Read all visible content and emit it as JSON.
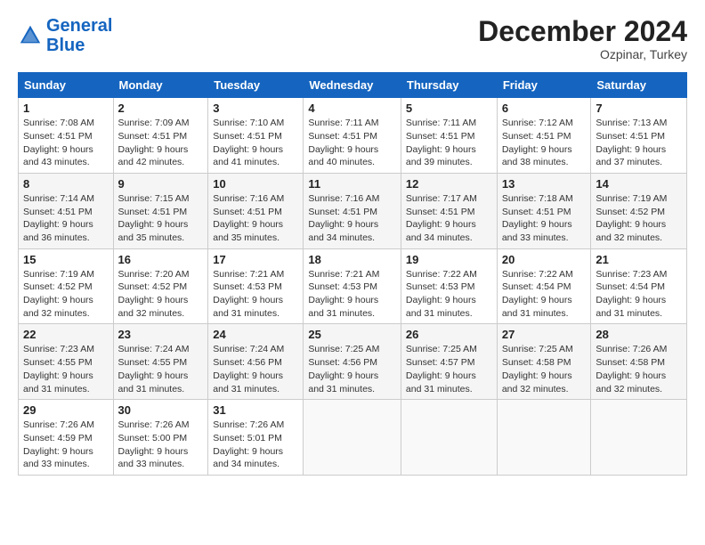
{
  "logo": {
    "line1": "General",
    "line2": "Blue"
  },
  "title": "December 2024",
  "location": "Ozpinar, Turkey",
  "days_header": [
    "Sunday",
    "Monday",
    "Tuesday",
    "Wednesday",
    "Thursday",
    "Friday",
    "Saturday"
  ],
  "weeks": [
    [
      {
        "num": "1",
        "rise": "7:08 AM",
        "set": "4:51 PM",
        "daylight": "9 hours and 43 minutes."
      },
      {
        "num": "2",
        "rise": "7:09 AM",
        "set": "4:51 PM",
        "daylight": "9 hours and 42 minutes."
      },
      {
        "num": "3",
        "rise": "7:10 AM",
        "set": "4:51 PM",
        "daylight": "9 hours and 41 minutes."
      },
      {
        "num": "4",
        "rise": "7:11 AM",
        "set": "4:51 PM",
        "daylight": "9 hours and 40 minutes."
      },
      {
        "num": "5",
        "rise": "7:11 AM",
        "set": "4:51 PM",
        "daylight": "9 hours and 39 minutes."
      },
      {
        "num": "6",
        "rise": "7:12 AM",
        "set": "4:51 PM",
        "daylight": "9 hours and 38 minutes."
      },
      {
        "num": "7",
        "rise": "7:13 AM",
        "set": "4:51 PM",
        "daylight": "9 hours and 37 minutes."
      }
    ],
    [
      {
        "num": "8",
        "rise": "7:14 AM",
        "set": "4:51 PM",
        "daylight": "9 hours and 36 minutes."
      },
      {
        "num": "9",
        "rise": "7:15 AM",
        "set": "4:51 PM",
        "daylight": "9 hours and 35 minutes."
      },
      {
        "num": "10",
        "rise": "7:16 AM",
        "set": "4:51 PM",
        "daylight": "9 hours and 35 minutes."
      },
      {
        "num": "11",
        "rise": "7:16 AM",
        "set": "4:51 PM",
        "daylight": "9 hours and 34 minutes."
      },
      {
        "num": "12",
        "rise": "7:17 AM",
        "set": "4:51 PM",
        "daylight": "9 hours and 34 minutes."
      },
      {
        "num": "13",
        "rise": "7:18 AM",
        "set": "4:51 PM",
        "daylight": "9 hours and 33 minutes."
      },
      {
        "num": "14",
        "rise": "7:19 AM",
        "set": "4:52 PM",
        "daylight": "9 hours and 32 minutes."
      }
    ],
    [
      {
        "num": "15",
        "rise": "7:19 AM",
        "set": "4:52 PM",
        "daylight": "9 hours and 32 minutes."
      },
      {
        "num": "16",
        "rise": "7:20 AM",
        "set": "4:52 PM",
        "daylight": "9 hours and 32 minutes."
      },
      {
        "num": "17",
        "rise": "7:21 AM",
        "set": "4:53 PM",
        "daylight": "9 hours and 31 minutes."
      },
      {
        "num": "18",
        "rise": "7:21 AM",
        "set": "4:53 PM",
        "daylight": "9 hours and 31 minutes."
      },
      {
        "num": "19",
        "rise": "7:22 AM",
        "set": "4:53 PM",
        "daylight": "9 hours and 31 minutes."
      },
      {
        "num": "20",
        "rise": "7:22 AM",
        "set": "4:54 PM",
        "daylight": "9 hours and 31 minutes."
      },
      {
        "num": "21",
        "rise": "7:23 AM",
        "set": "4:54 PM",
        "daylight": "9 hours and 31 minutes."
      }
    ],
    [
      {
        "num": "22",
        "rise": "7:23 AM",
        "set": "4:55 PM",
        "daylight": "9 hours and 31 minutes."
      },
      {
        "num": "23",
        "rise": "7:24 AM",
        "set": "4:55 PM",
        "daylight": "9 hours and 31 minutes."
      },
      {
        "num": "24",
        "rise": "7:24 AM",
        "set": "4:56 PM",
        "daylight": "9 hours and 31 minutes."
      },
      {
        "num": "25",
        "rise": "7:25 AM",
        "set": "4:56 PM",
        "daylight": "9 hours and 31 minutes."
      },
      {
        "num": "26",
        "rise": "7:25 AM",
        "set": "4:57 PM",
        "daylight": "9 hours and 31 minutes."
      },
      {
        "num": "27",
        "rise": "7:25 AM",
        "set": "4:58 PM",
        "daylight": "9 hours and 32 minutes."
      },
      {
        "num": "28",
        "rise": "7:26 AM",
        "set": "4:58 PM",
        "daylight": "9 hours and 32 minutes."
      }
    ],
    [
      {
        "num": "29",
        "rise": "7:26 AM",
        "set": "4:59 PM",
        "daylight": "9 hours and 33 minutes."
      },
      {
        "num": "30",
        "rise": "7:26 AM",
        "set": "5:00 PM",
        "daylight": "9 hours and 33 minutes."
      },
      {
        "num": "31",
        "rise": "7:26 AM",
        "set": "5:01 PM",
        "daylight": "9 hours and 34 minutes."
      },
      null,
      null,
      null,
      null
    ]
  ]
}
